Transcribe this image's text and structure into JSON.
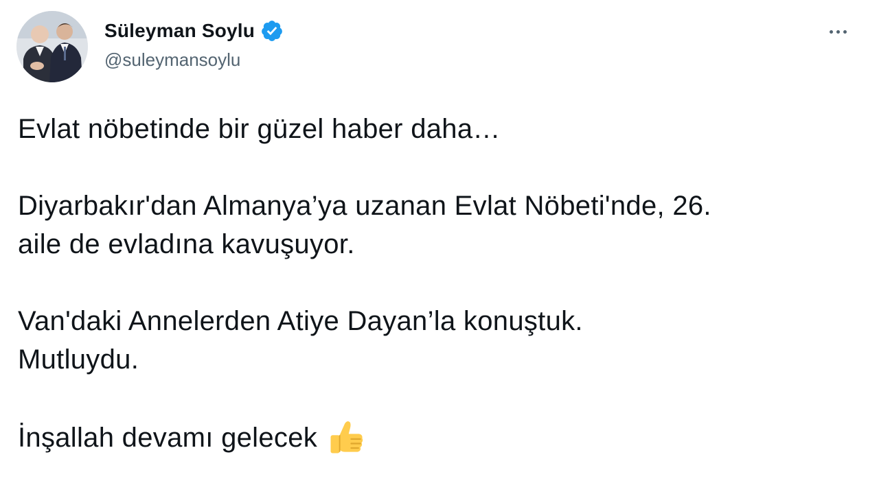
{
  "author": {
    "display_name": "Süleyman Soylu",
    "handle": "@suleymansoylu",
    "verified_icon": "verified-badge-icon",
    "verified_color": "#1d9bf0"
  },
  "menu": {
    "icon": "more-horizontal-icon"
  },
  "tweet": {
    "paragraphs": [
      "Evlat nöbetinde bir güzel haber daha…",
      "Diyarbakır'dan Almanya’ya uzanan Evlat Nöbeti'nde, 26.\naile de evladına kavuşuyor.",
      "Van'daki Annelerden Atiye Dayan’la konuştuk.\nMutluydu.",
      "İnşallah devamı gelecek"
    ],
    "emoji_icon": "thumbs-up-icon"
  },
  "colors": {
    "text": "#0f1419",
    "secondary": "#536471",
    "accent": "#1d9bf0"
  }
}
